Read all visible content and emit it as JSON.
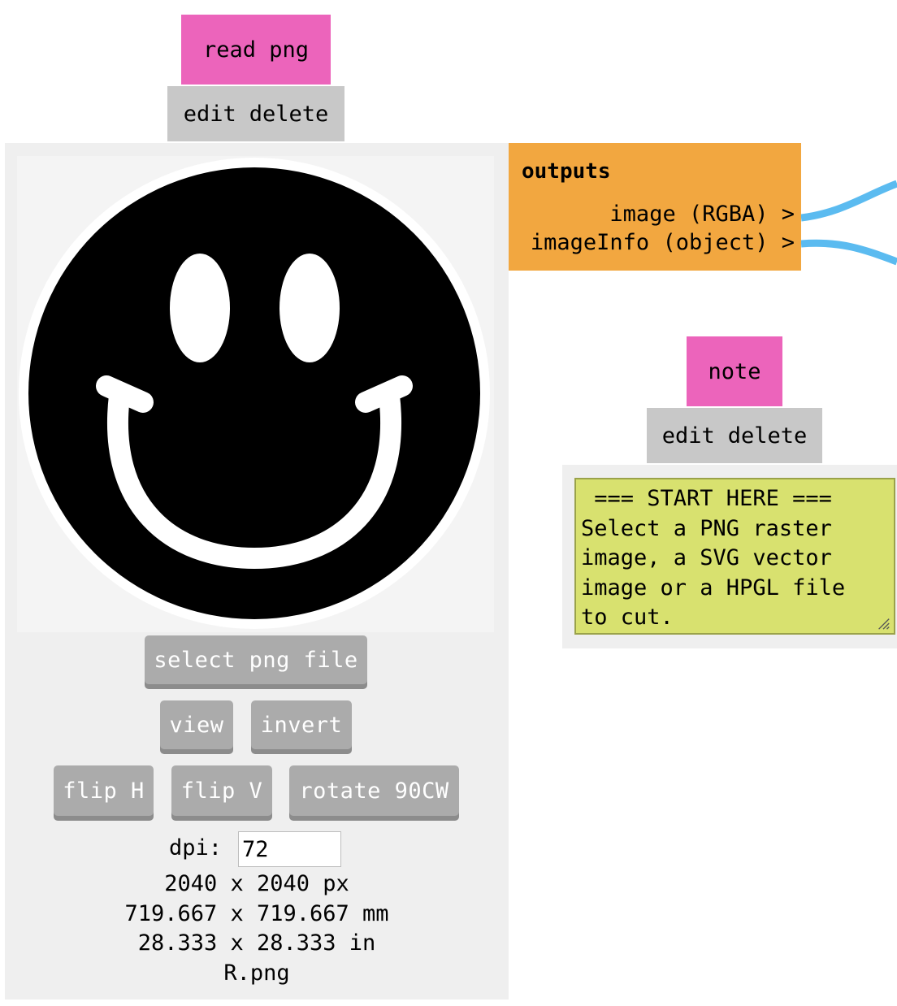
{
  "read_png": {
    "title": "read png",
    "edit": "edit",
    "delete": "delete",
    "buttons": {
      "select": "select png file",
      "view": "view",
      "invert": "invert",
      "flip_h": "flip H",
      "flip_v": "flip V",
      "rotate": "rotate 90CW"
    },
    "dpi_label": "dpi:",
    "dpi_value": "72",
    "size_px": "2040 x 2040 px",
    "size_mm": "719.667 x 719.667 mm",
    "size_in": "28.333 x 28.333 in",
    "filename": "R.png"
  },
  "outputs": {
    "heading": "outputs",
    "ports": [
      "image (RGBA) >",
      "imageInfo (object) >"
    ]
  },
  "note": {
    "title": "note",
    "edit": "edit",
    "delete": "delete",
    "text": " === START HERE ===\nSelect a PNG raster\nimage, a SVG vector\nimage or a HPGL file\nto cut."
  },
  "colors": {
    "module_title": "#ec64bb",
    "action_bar": "#c8c8c8",
    "outputs": "#f2a740",
    "note_bg": "#d8e16f",
    "wire": "#5bbbf0",
    "button": "#ababab"
  }
}
